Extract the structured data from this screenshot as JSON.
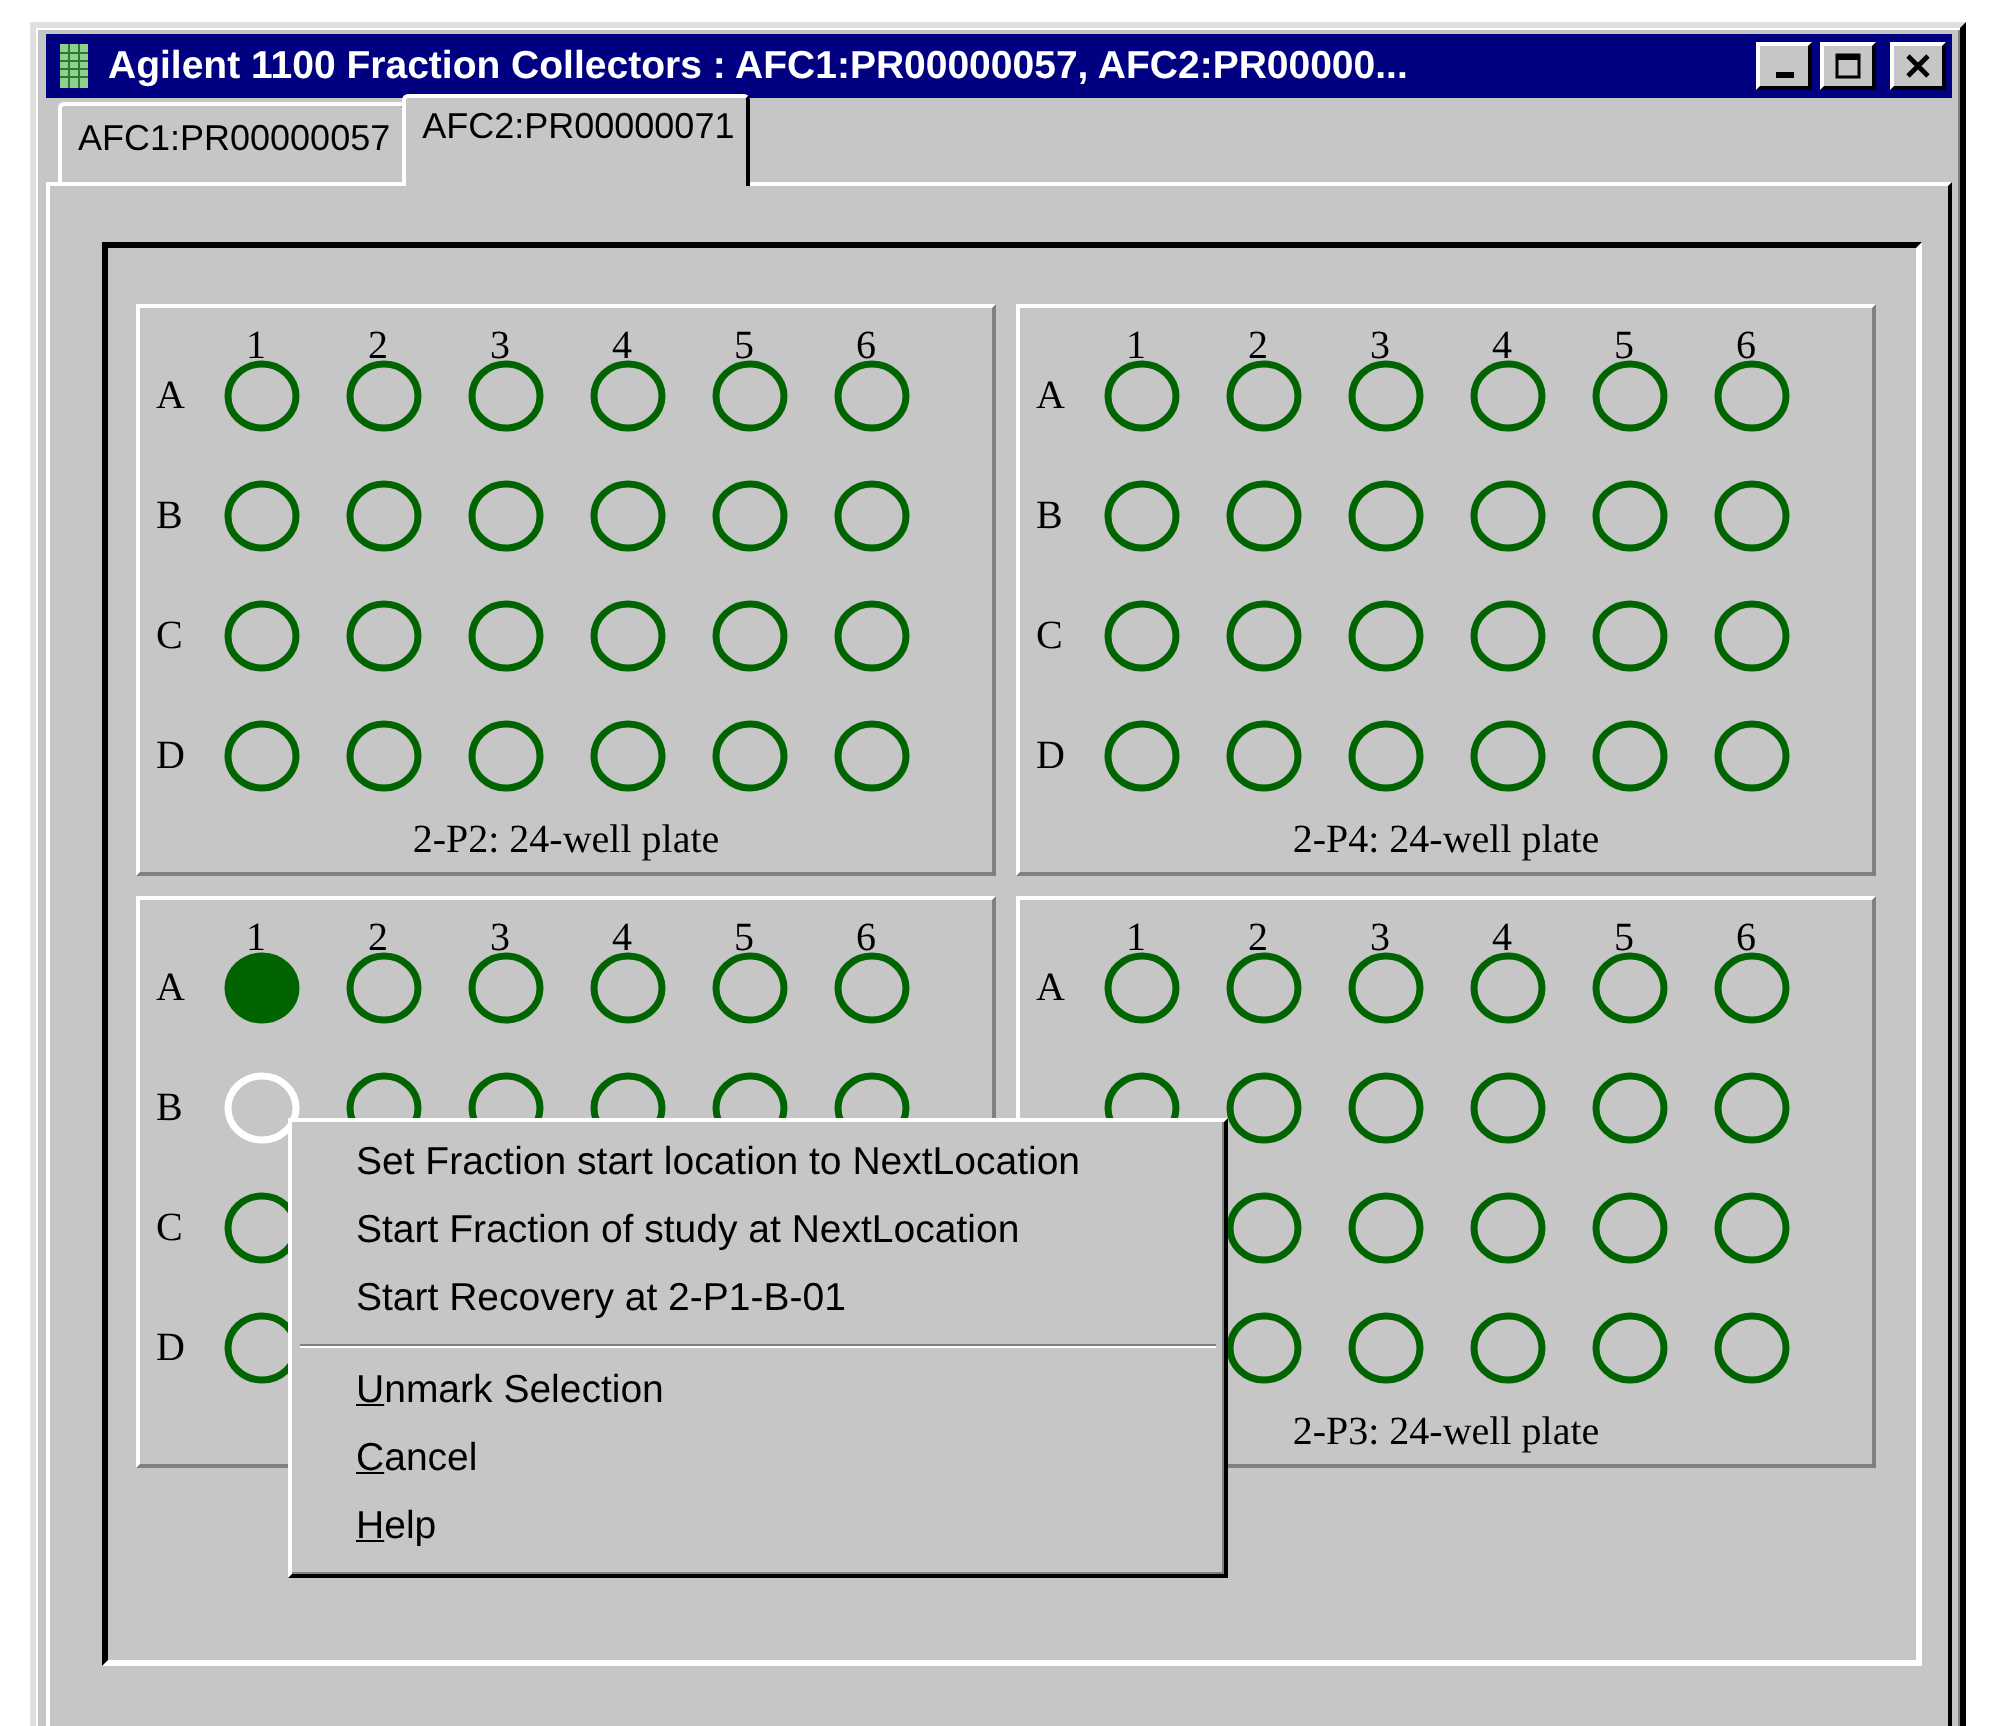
{
  "window": {
    "title": "Agilent 1100 Fraction Collectors : AFC1:PR00000057, AFC2:PR00000..."
  },
  "tabs": [
    {
      "label": "AFC1:PR00000057",
      "selected": false
    },
    {
      "label": "AFC2:PR00000071",
      "selected": true
    }
  ],
  "plates": [
    {
      "columns": [
        "1",
        "2",
        "3",
        "4",
        "5",
        "6"
      ],
      "label": "2-P2: 24-well plate",
      "rows": [
        {
          "letter": "A",
          "wells": [
            {
              "filled": false,
              "selected": false
            },
            {
              "filled": false,
              "selected": false
            },
            {
              "filled": false,
              "selected": false
            },
            {
              "filled": false,
              "selected": false
            },
            {
              "filled": false,
              "selected": false
            },
            {
              "filled": false,
              "selected": false
            }
          ]
        },
        {
          "letter": "B",
          "wells": [
            {
              "filled": false,
              "selected": false
            },
            {
              "filled": false,
              "selected": false
            },
            {
              "filled": false,
              "selected": false
            },
            {
              "filled": false,
              "selected": false
            },
            {
              "filled": false,
              "selected": false
            },
            {
              "filled": false,
              "selected": false
            }
          ]
        },
        {
          "letter": "C",
          "wells": [
            {
              "filled": false,
              "selected": false
            },
            {
              "filled": false,
              "selected": false
            },
            {
              "filled": false,
              "selected": false
            },
            {
              "filled": false,
              "selected": false
            },
            {
              "filled": false,
              "selected": false
            },
            {
              "filled": false,
              "selected": false
            }
          ]
        },
        {
          "letter": "D",
          "wells": [
            {
              "filled": false,
              "selected": false
            },
            {
              "filled": false,
              "selected": false
            },
            {
              "filled": false,
              "selected": false
            },
            {
              "filled": false,
              "selected": false
            },
            {
              "filled": false,
              "selected": false
            },
            {
              "filled": false,
              "selected": false
            }
          ]
        }
      ]
    },
    {
      "columns": [
        "1",
        "2",
        "3",
        "4",
        "5",
        "6"
      ],
      "label": "2-P4: 24-well plate",
      "rows": [
        {
          "letter": "A",
          "wells": [
            {
              "filled": false,
              "selected": false
            },
            {
              "filled": false,
              "selected": false
            },
            {
              "filled": false,
              "selected": false
            },
            {
              "filled": false,
              "selected": false
            },
            {
              "filled": false,
              "selected": false
            },
            {
              "filled": false,
              "selected": false
            }
          ]
        },
        {
          "letter": "B",
          "wells": [
            {
              "filled": false,
              "selected": false
            },
            {
              "filled": false,
              "selected": false
            },
            {
              "filled": false,
              "selected": false
            },
            {
              "filled": false,
              "selected": false
            },
            {
              "filled": false,
              "selected": false
            },
            {
              "filled": false,
              "selected": false
            }
          ]
        },
        {
          "letter": "C",
          "wells": [
            {
              "filled": false,
              "selected": false
            },
            {
              "filled": false,
              "selected": false
            },
            {
              "filled": false,
              "selected": false
            },
            {
              "filled": false,
              "selected": false
            },
            {
              "filled": false,
              "selected": false
            },
            {
              "filled": false,
              "selected": false
            }
          ]
        },
        {
          "letter": "D",
          "wells": [
            {
              "filled": false,
              "selected": false
            },
            {
              "filled": false,
              "selected": false
            },
            {
              "filled": false,
              "selected": false
            },
            {
              "filled": false,
              "selected": false
            },
            {
              "filled": false,
              "selected": false
            },
            {
              "filled": false,
              "selected": false
            }
          ]
        }
      ]
    },
    {
      "columns": [
        "1",
        "2",
        "3",
        "4",
        "5",
        "6"
      ],
      "rows": [
        {
          "letter": "A",
          "wells": [
            {
              "filled": true,
              "selected": false
            },
            {
              "filled": false,
              "selected": false
            },
            {
              "filled": false,
              "selected": false
            },
            {
              "filled": false,
              "selected": false
            },
            {
              "filled": false,
              "selected": false
            },
            {
              "filled": false,
              "selected": false
            }
          ]
        },
        {
          "letter": "B",
          "wells": [
            {
              "filled": false,
              "selected": true
            },
            {
              "filled": false,
              "selected": false
            },
            {
              "filled": false,
              "selected": false
            },
            {
              "filled": false,
              "selected": false
            },
            {
              "filled": false,
              "selected": false
            },
            {
              "filled": false,
              "selected": false
            }
          ]
        },
        {
          "letter": "C",
          "wells": [
            {
              "filled": false,
              "selected": false
            }
          ]
        },
        {
          "letter": "D",
          "wells": [
            {
              "filled": false,
              "selected": false
            }
          ]
        }
      ]
    },
    {
      "columns": [
        "1",
        "2",
        "3",
        "4",
        "5",
        "6"
      ],
      "label": "2-P3: 24-well plate",
      "rows": [
        {
          "kind": "full",
          "letter": "A",
          "wells": [
            {
              "filled": false,
              "selected": false
            },
            {
              "filled": false,
              "selected": false
            },
            {
              "filled": false,
              "selected": false
            },
            {
              "filled": false,
              "selected": false
            },
            {
              "filled": false,
              "selected": false
            },
            {
              "filled": false,
              "selected": false
            }
          ]
        },
        {
          "kind": "full",
          "wells": [
            {
              "filled": false,
              "selected": false
            },
            {
              "filled": false,
              "selected": false
            },
            {
              "filled": false,
              "selected": false
            },
            {
              "filled": false,
              "selected": false
            },
            {
              "filled": false,
              "selected": false
            },
            {
              "filled": false,
              "selected": false
            }
          ]
        },
        {
          "kind": "covered",
          "wells": [
            {
              "filled": false,
              "selected": false
            },
            {
              "filled": false,
              "selected": false
            },
            {
              "filled": false,
              "selected": false
            },
            {
              "filled": false,
              "selected": false
            },
            {
              "filled": false,
              "selected": false
            }
          ]
        },
        {
          "kind": "covered",
          "wells": [
            {
              "filled": false,
              "selected": false
            },
            {
              "filled": false,
              "selected": false
            },
            {
              "filled": false,
              "selected": false
            },
            {
              "filled": false,
              "selected": false
            },
            {
              "filled": false,
              "selected": false
            }
          ]
        }
      ]
    }
  ],
  "context_menu": [
    {
      "kind": "item",
      "label": "Set Fraction start location to NextLocation",
      "mnemonic": false
    },
    {
      "kind": "item",
      "label": "Start Fraction of study at NextLocation",
      "mnemonic": false
    },
    {
      "kind": "item",
      "label": "Start Recovery at 2-P1-B-01",
      "mnemonic": false
    },
    {
      "kind": "separator"
    },
    {
      "kind": "item",
      "label": "Unmark Selection",
      "mnemonic": true
    },
    {
      "kind": "item",
      "label": "Cancel",
      "mnemonic": true
    },
    {
      "kind": "item",
      "label": "Help",
      "mnemonic": true
    }
  ]
}
